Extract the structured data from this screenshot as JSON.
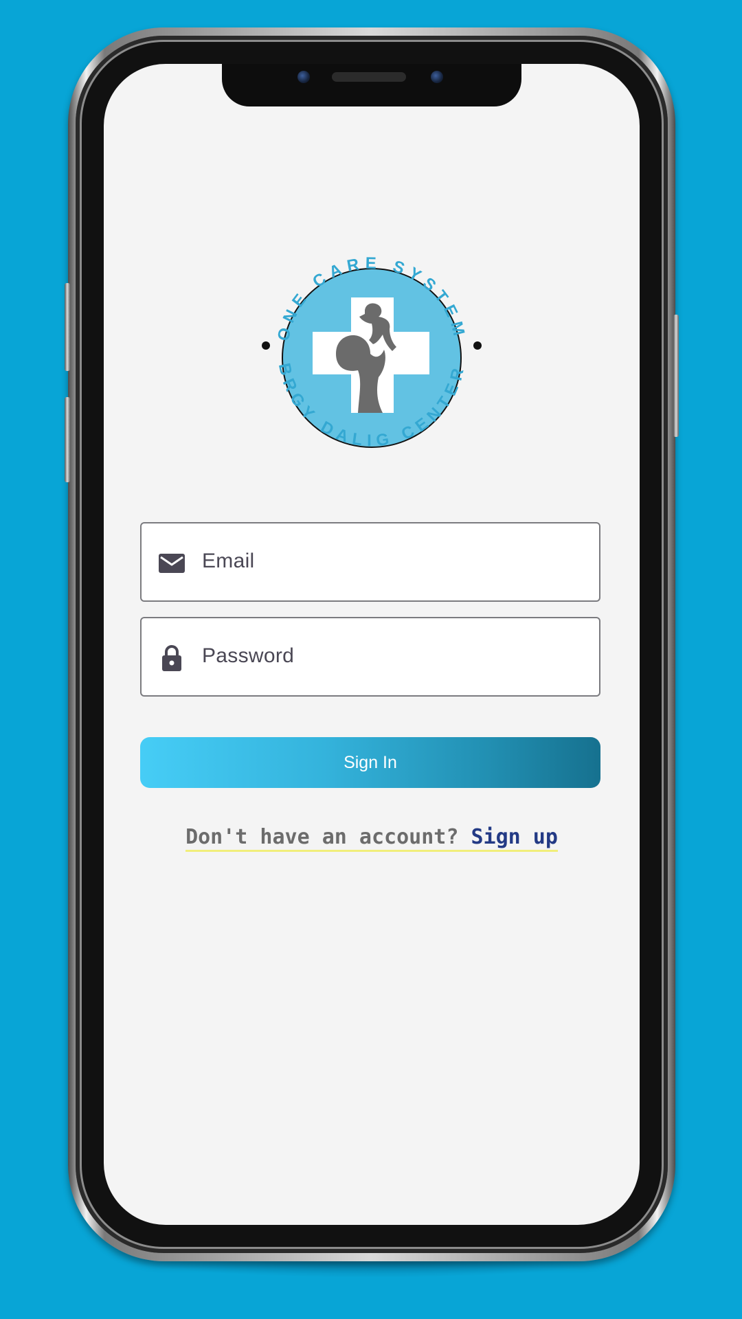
{
  "logo": {
    "top_text": "ONE CARE SYSTEM",
    "bottom_text": "BRGY DALIG CENTER",
    "ring_color": "#34a8d2",
    "circle_color": "#62c2e3",
    "silhouette_color": "#6b6b6b"
  },
  "form": {
    "email": {
      "placeholder": "Email",
      "icon": "envelope-icon"
    },
    "password": {
      "placeholder": "Password",
      "icon": "lock-icon"
    },
    "signin_label": "Sign In"
  },
  "signup": {
    "prefix": "Don't have an account?",
    "link": "Sign up"
  },
  "colors": {
    "background": "#08a5d6",
    "screen": "#f4f4f4",
    "button_start": "#46cdf6",
    "button_end": "#16718f",
    "link": "#233a85"
  }
}
